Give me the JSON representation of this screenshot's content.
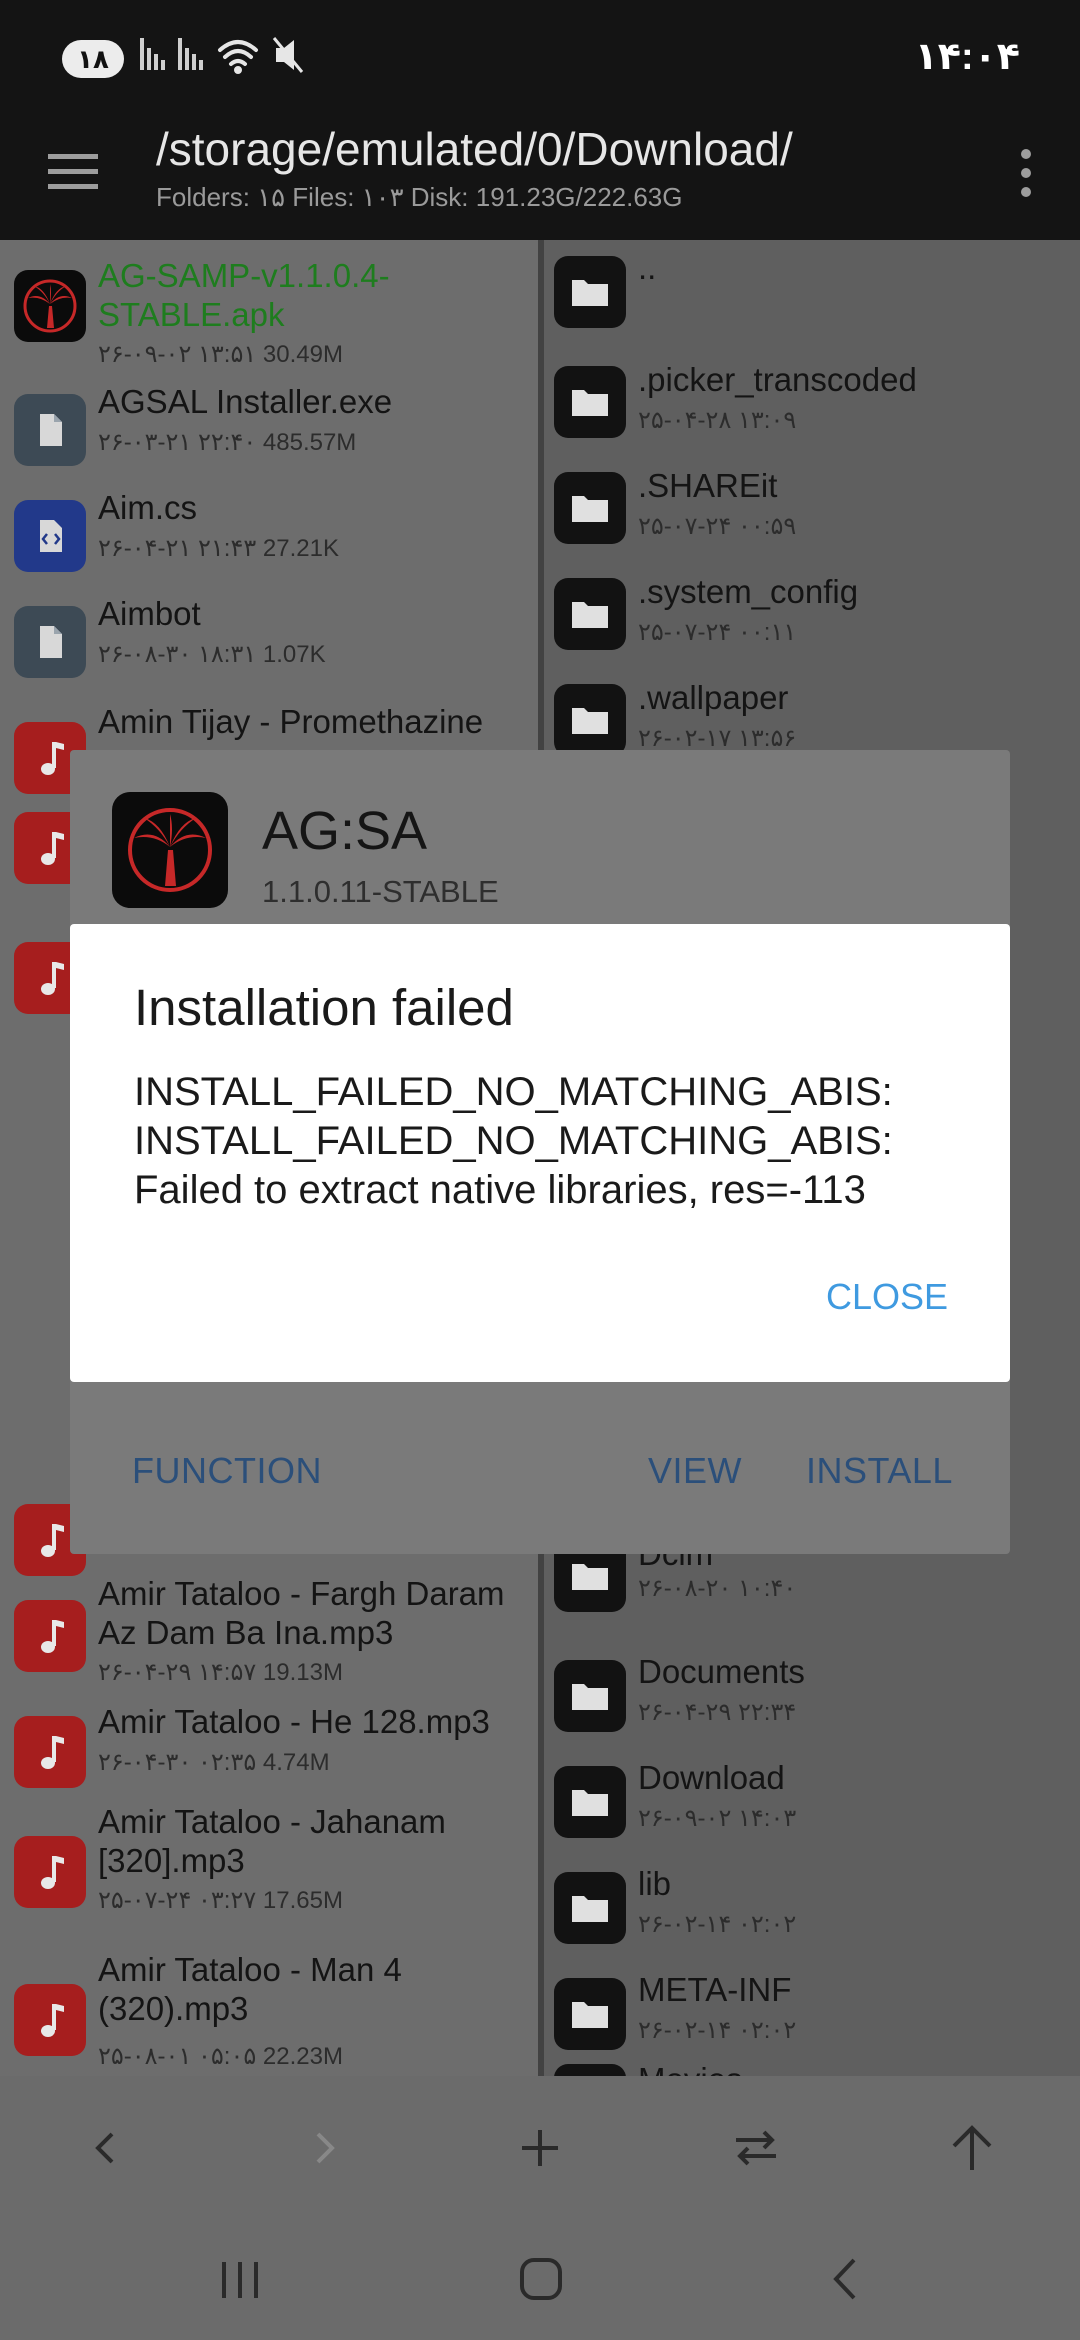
{
  "status_bar": {
    "badge": "۱۸",
    "time": "۱۴:۰۴",
    "icons": [
      "signal-icon",
      "signal-icon",
      "wifi-icon",
      "mute-icon"
    ]
  },
  "toolbar": {
    "path": "/storage/emulated/0/Download/",
    "info": "Folders: ۱۵  Files: ۱۰۳  Disk: 191.23G/222.63G"
  },
  "left_pane": {
    "items": [
      {
        "name": "AG-SAMP-v1.1.0.4-STABLE.apk",
        "meta": "۲۶-۰۹-۰۲ ۱۳:۵۱  30.49M",
        "icon": "palm-app-icon"
      },
      {
        "name": "AGSAL Installer.exe",
        "meta": "۲۶-۰۳-۲۱ ۲۲:۴۰  485.57M",
        "icon": "file-icon"
      },
      {
        "name": "Aim.cs",
        "meta": "۲۶-۰۴-۲۱ ۲۱:۴۳  27.21K",
        "icon": "code-file-icon"
      },
      {
        "name": "Aimbot",
        "meta": "۲۶-۰۸-۳۰ ۱۸:۳۱  1.07K",
        "icon": "file-icon"
      },
      {
        "name": "Amin Tijay - Promethazine",
        "meta": "",
        "icon": "music-icon"
      },
      {
        "name": "Amir Tataloo - Fargh Daram Az Dam Ba Ina.mp3",
        "meta": "۲۶-۰۴-۲۹ ۱۴:۵۷  19.13M",
        "icon": "music-icon"
      },
      {
        "name": "Amir Tataloo - He 128.mp3",
        "meta": "۲۶-۰۴-۳۰ ۰۲:۳۵  4.74M",
        "icon": "music-icon"
      },
      {
        "name": "Amir Tataloo - Jahanam [320].mp3",
        "meta": "۲۵-۰۷-۲۴ ۰۳:۲۷  17.65M",
        "icon": "music-icon"
      },
      {
        "name": "Amir Tataloo - Man 4 (320).mp3",
        "meta": "۲۵-۰۸-۰۱ ۰۵:۰۵  22.23M",
        "icon": "music-icon"
      }
    ]
  },
  "right_pane": {
    "items": [
      {
        "name": "..",
        "meta": ""
      },
      {
        "name": ".picker_transcoded",
        "meta": "۲۵-۰۴-۲۸ ۱۳:۰۹"
      },
      {
        "name": ".SHAREit",
        "meta": "۲۵-۰۷-۲۴ ۰۰:۵۹"
      },
      {
        "name": ".system_config",
        "meta": "۲۵-۰۷-۲۴ ۰۰:۱۱"
      },
      {
        "name": ".wallpaper",
        "meta": "۲۶-۰۲-۱۷ ۱۳:۵۶"
      },
      {
        "name": "Dcim",
        "meta": "۲۶-۰۸-۲۰ ۱۰:۴۰"
      },
      {
        "name": "Documents",
        "meta": "۲۶-۰۴-۲۹ ۲۲:۳۴"
      },
      {
        "name": "Download",
        "meta": "۲۶-۰۹-۰۲ ۱۴:۰۳"
      },
      {
        "name": "lib",
        "meta": "۲۶-۰۲-۱۴ ۰۲:۰۲"
      },
      {
        "name": "META-INF",
        "meta": "۲۶-۰۲-۱۴ ۰۲:۰۲"
      },
      {
        "name": "Movies",
        "meta": ""
      }
    ]
  },
  "installer_dialog": {
    "app_name": "AG:SA",
    "version": "1.1.0.11-STABLE",
    "function_label": "FUNCTION",
    "view_label": "VIEW",
    "install_label": "INSTALL"
  },
  "error_dialog": {
    "title": "Installation failed",
    "message": "INSTALL_FAILED_NO_MATCHING_ABIS: INSTALL_FAILED_NO_MATCHING_ABIS: Failed to extract native libraries, res=-113",
    "close_label": "CLOSE"
  },
  "bottom_bar": {
    "buttons": [
      "back-arrow-icon",
      "forward-arrow-icon",
      "add-icon",
      "swap-icon",
      "up-arrow-icon"
    ]
  },
  "nav_bar": {
    "buttons": [
      "recents-icon",
      "home-icon",
      "back-icon"
    ]
  },
  "colors": {
    "accent": "#3f9ae0",
    "music_icon": "#a61e1e",
    "code_icon": "#22398a",
    "file_icon": "#3d4a55",
    "folder_icon": "#121212"
  }
}
